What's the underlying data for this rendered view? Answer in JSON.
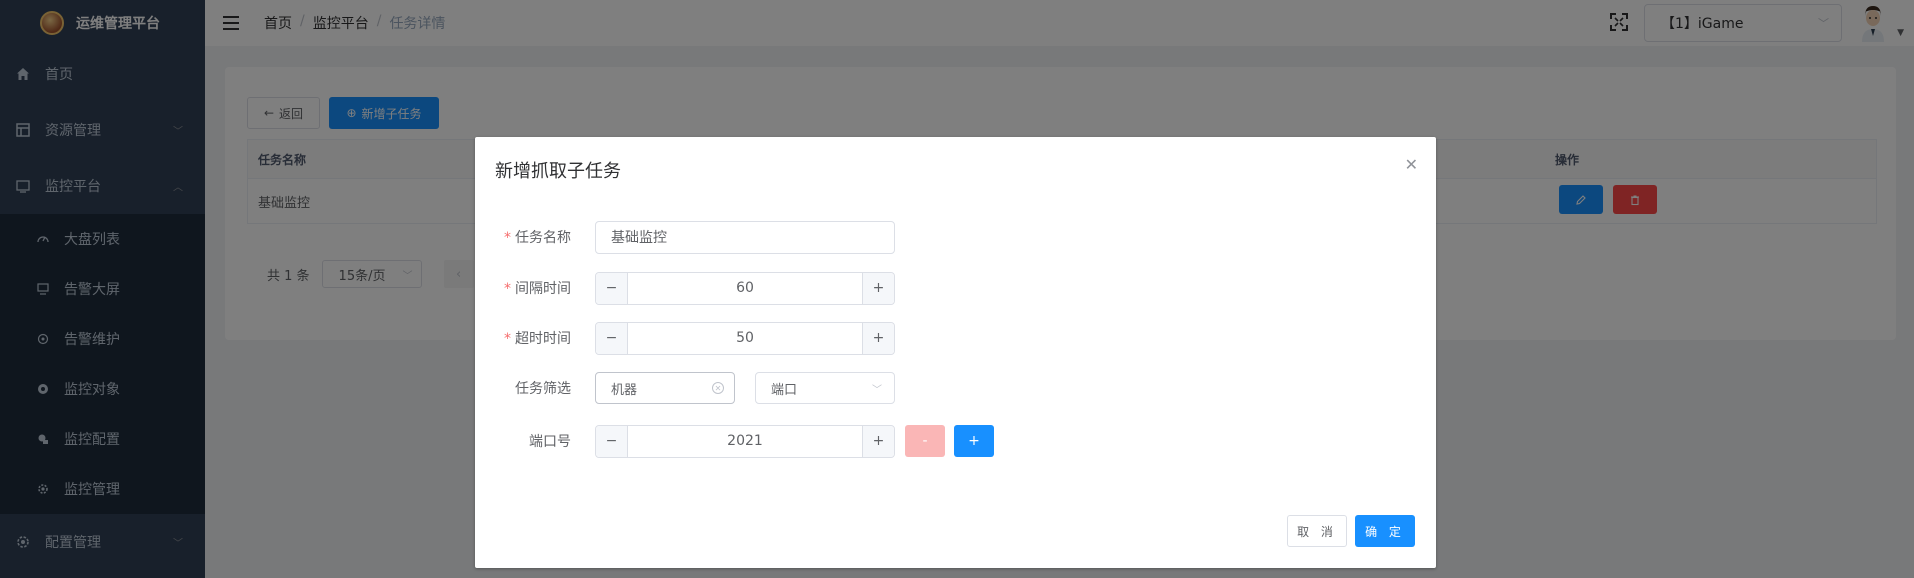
{
  "brand": {
    "title": "运维管理平台"
  },
  "sidebar": {
    "items": [
      {
        "label": "首页",
        "icon": "home-icon"
      },
      {
        "label": "资源管理",
        "icon": "table-icon"
      },
      {
        "label": "监控平台",
        "icon": "monitor-icon"
      },
      {
        "label": "配置管理",
        "icon": "settings-icon"
      }
    ],
    "sub_items": [
      {
        "label": "大盘列表",
        "icon": "dashboard-icon"
      },
      {
        "label": "告警大屏",
        "icon": "screen-icon"
      },
      {
        "label": "告警维护",
        "icon": "maintain-icon"
      },
      {
        "label": "监控对象",
        "icon": "target-icon"
      },
      {
        "label": "监控配置",
        "icon": "config-icon"
      },
      {
        "label": "监控管理",
        "icon": "manage-icon"
      }
    ]
  },
  "header": {
    "breadcrumb": [
      "首页",
      "监控平台",
      "任务详情"
    ],
    "tenant_select": "【1】iGame"
  },
  "main": {
    "back_label": "返回",
    "add_sub_label": "新增子任务",
    "table": {
      "headers": [
        "任务名称",
        "操作"
      ],
      "rows": [
        {
          "name": "基础监控"
        }
      ]
    },
    "pager": {
      "total": "共 1 条",
      "page_size": "15条/页"
    }
  },
  "dialog": {
    "title": "新增抓取子任务",
    "fields": {
      "task_name": {
        "label": "任务名称",
        "value": "基础监控"
      },
      "interval": {
        "label": "间隔时间",
        "value": "60"
      },
      "timeout": {
        "label": "超时时间",
        "value": "50"
      },
      "filter": {
        "label": "任务筛选",
        "value1": "机器",
        "value2": "端口"
      },
      "port": {
        "label": "端口号",
        "value": "2021"
      }
    },
    "cancel_label": "取 消",
    "ok_label": "确 定"
  },
  "colors": {
    "sidebar_bg": "#304156",
    "submenu_bg": "#1f2d3d",
    "primary": "#1890ff",
    "danger": "#ff4949",
    "danger_light": "#fab6b6",
    "required": "#f56c6c"
  }
}
